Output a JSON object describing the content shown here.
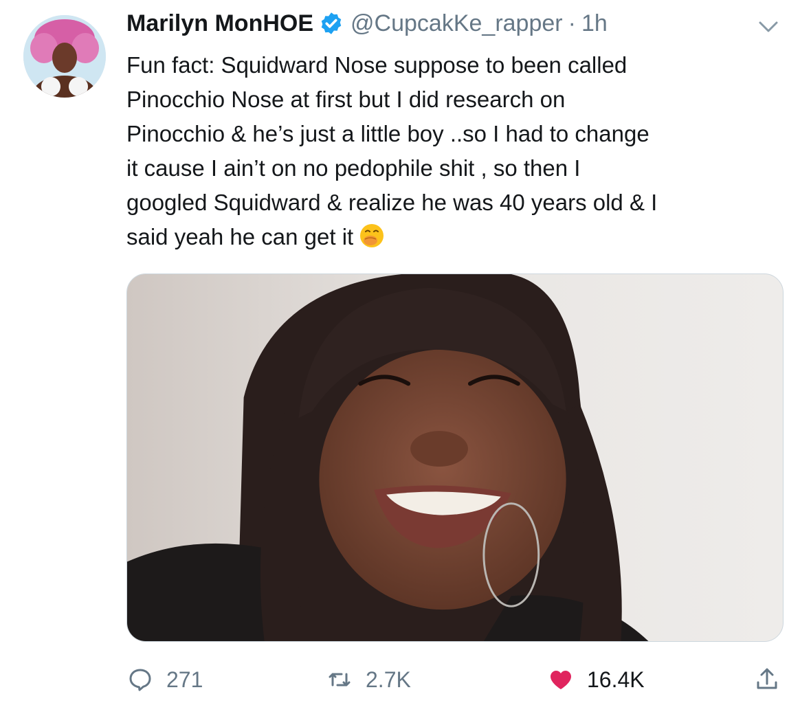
{
  "tweet": {
    "display_name": "Marilyn MonHOE",
    "handle": "@CupcakKe_rapper",
    "separator": "·",
    "time": "1h",
    "text_lines": [
      "Fun fact:  Squidward Nose suppose to been called",
      "Pinocchio Nose at first but I did research on",
      "Pinocchio & he’s just a little boy ..so I had to change",
      "it cause I ain’t on no pedophile shit , so then I",
      "googled Squidward & realize he was 40 years old & I",
      "said yeah he can get it"
    ],
    "emoji": "face-with-hand-over-mouth-emoji"
  },
  "actions": {
    "replies": "271",
    "retweets": "2.7K",
    "likes": "16.4K"
  },
  "colors": {
    "verified": "#1da1f2",
    "like": "#e0245e",
    "muted": "#657786",
    "text": "#14171a"
  },
  "icons": {
    "reply": "speech-bubble-icon",
    "retweet": "retweet-arrows-icon",
    "like": "heart-icon",
    "share": "share-upload-icon",
    "more": "chevron-down-icon",
    "verified": "verified-badge-icon"
  }
}
